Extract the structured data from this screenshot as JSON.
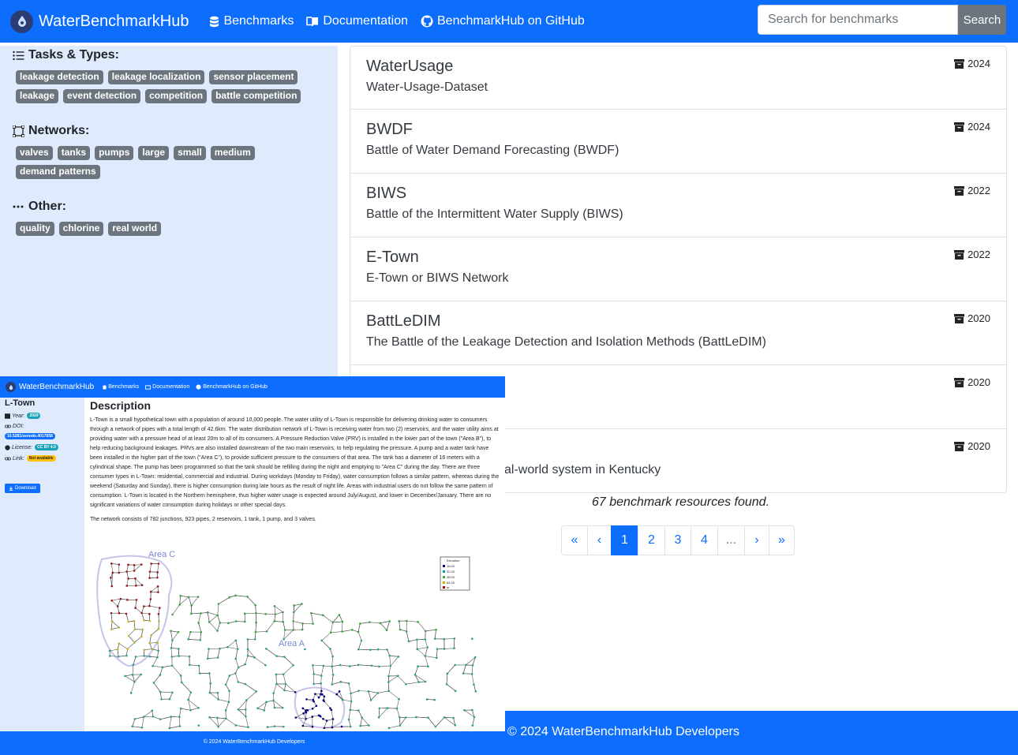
{
  "navbar": {
    "brand": "WaterBenchmarkHub",
    "links": [
      {
        "label": "Benchmarks",
        "icon": "database-icon"
      },
      {
        "label": "Documentation",
        "icon": "book-icon"
      },
      {
        "label": "BenchmarkHub on GitHub",
        "icon": "github-icon"
      }
    ],
    "search_placeholder": "Search for benchmarks",
    "search_button": "Search"
  },
  "sidebar": {
    "tasks_title": "Tasks & Types:",
    "tasks": [
      "leakage detection",
      "leakage localization",
      "sensor placement",
      "leakage",
      "event detection",
      "competition",
      "battle competition"
    ],
    "networks_title": "Networks:",
    "networks": [
      "valves",
      "tanks",
      "pumps",
      "large",
      "small",
      "medium",
      "demand patterns"
    ],
    "other_title": "Other:",
    "other": [
      "quality",
      "chlorine",
      "real world"
    ]
  },
  "results": [
    {
      "title": "WaterUsage",
      "subtitle": "Water-Usage-Dataset",
      "year": "2024"
    },
    {
      "title": "BWDF",
      "subtitle": "Battle of Water Demand Forecasting (BWDF)",
      "year": "2024"
    },
    {
      "title": "BIWS",
      "subtitle": "Battle of the Intermittent Water Supply (BIWS)",
      "year": "2022"
    },
    {
      "title": "E-Town",
      "subtitle": "E-Town or BIWS Network",
      "year": "2022"
    },
    {
      "title": "BattLeDIM",
      "subtitle": "The Battle of the Leakage Detection and Isolation Methods (BattLeDIM)",
      "year": "2020"
    },
    {
      "title": "",
      "subtitle": "",
      "year": "2020"
    },
    {
      "title": "",
      "subtitle": "al-world system in Kentucky",
      "year": "2020"
    }
  ],
  "found_text": "67 benchmark resources found.",
  "pagination": [
    "«",
    "‹",
    "1",
    "2",
    "3",
    "4",
    "...",
    "›",
    "»"
  ],
  "pagination_active": "1",
  "footer_text": "© 2024 WaterBenchmarkHub Developers",
  "overlay": {
    "brand": "WaterBenchmarkHub",
    "links": [
      "Benchmarks",
      "Documentation",
      "BenchmarkHub on GitHub"
    ],
    "name": "L-Town",
    "year_label": "Year:",
    "year": "2020",
    "doi_label": "DOI:",
    "doi": "10.5281/zenodo.4017658",
    "license_label": "License:",
    "license": "CC BY 4.0",
    "link_label": "Link:",
    "link": "Not available",
    "download": "Download",
    "heading": "Description",
    "paragraph": "L-Town is a small hypothetical town with a population of around 10,000 people. The water utility of L-Town is responsible for delivering drinking water to consumers through a network of pipes with a total length of 42.6km. The water distribution network of L-Town is receiving water from two (2) reservoirs, and the water utility aims at providing water with a pressure head of at least 20m to all of its consumers. A Pressure Reduction Valve (PRV) is installed in the lower part of the town (\"Area B\"), to help reducing background leakages. PRVs are also installed downstream of the two main reservoirs, to help regulating the pressure. A pump and a water tank have been installed in the higher part of the town (\"Area C\"), to provide sufficient pressure to the consumers of that area. The tank has a diameter of 16 meters with a cylindrical shape. The pump has been programmed so that the tank should be refilling during the night and emptying to \"Area C\" during the day. There are three consumer types in L-Town: residential, commercial and industrial. During workdays (Monday to Friday), water consumption follows a similar pattern, whereas during the weekend (Saturday and Sunday), there is higher consumption during late hours as the result of night life. Areas with industrial users do not follow the same pattern of consumption. L-Town is located in the Northern hemisphere, thus higher water usage is expected around July/August, and lower in December/January. There are no significant variations of water consumption during holidays or other special days.",
    "paragraph2": "The network consists of 782 junctions, 923 pipes, 2 reservoirs, 1 tank, 1 pump, and 3 valves.",
    "map_area_c": "Area C",
    "map_area_a": "Area A",
    "legend_title": "Elevation",
    "legend_items": [
      "16.00",
      "32.00",
      "48.00",
      "64.00",
      "m"
    ],
    "footer": "© 2024 WaterBenchmarkHub Developers"
  },
  "colors": {
    "primary": "#0d6efd",
    "sidebar_bg": "#dfeafd",
    "tag_bg": "#6c757d"
  }
}
